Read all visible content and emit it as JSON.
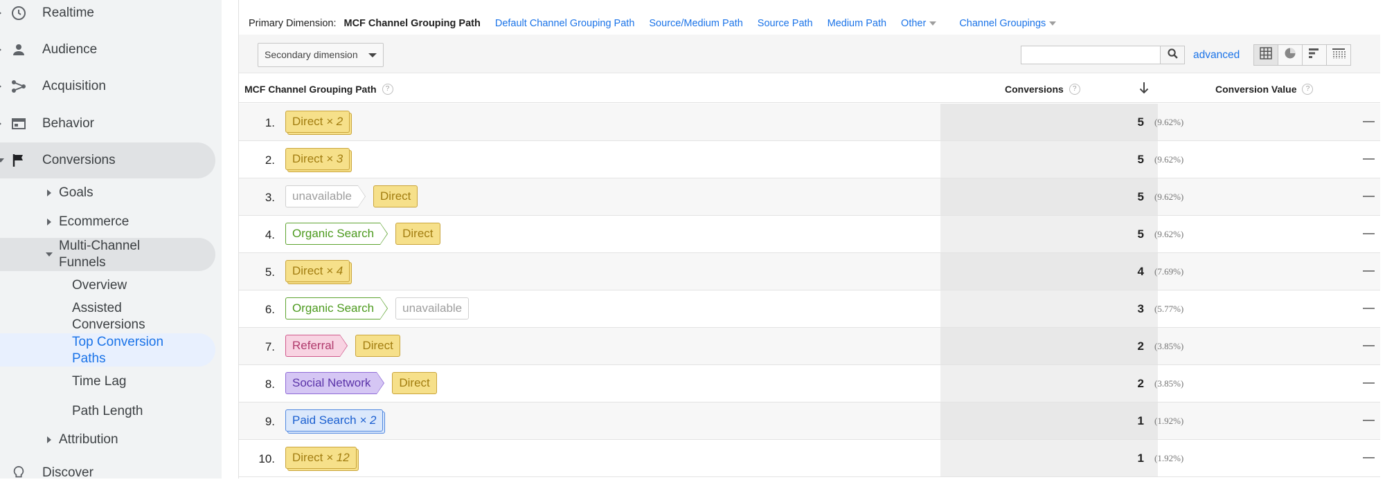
{
  "sidebar": {
    "top_items": [
      {
        "label": "Realtime",
        "icon": "clock-icon"
      },
      {
        "label": "Audience",
        "icon": "person-icon"
      },
      {
        "label": "Acquisition",
        "icon": "acquisition-icon"
      },
      {
        "label": "Behavior",
        "icon": "behavior-icon"
      },
      {
        "label": "Conversions",
        "icon": "flag-icon"
      }
    ],
    "conversion_items": [
      {
        "label": "Goals"
      },
      {
        "label": "Ecommerce"
      },
      {
        "label": "Multi-Channel Funnels"
      }
    ],
    "mcf_items": [
      {
        "label": "Overview"
      },
      {
        "label": "Assisted Conversions"
      },
      {
        "label": "Top Conversion Paths"
      },
      {
        "label": "Time Lag"
      },
      {
        "label": "Path Length"
      }
    ],
    "attribution_label": "Attribution",
    "discover": {
      "label": "Discover",
      "icon": "lightbulb-icon"
    }
  },
  "dimensions": {
    "label": "Primary Dimension:",
    "active": "MCF Channel Grouping Path",
    "links": [
      "Default Channel Grouping Path",
      "Source/Medium Path",
      "Source Path",
      "Medium Path"
    ],
    "other": "Other",
    "channel_groupings": "Channel Groupings"
  },
  "toolbar": {
    "secondary_dimension": "Secondary dimension",
    "search_value": "",
    "advanced": "advanced"
  },
  "table": {
    "col_path": "MCF Channel Grouping Path",
    "col_conversions": "Conversions",
    "col_value": "Conversion Value",
    "rows": [
      {
        "num": "1.",
        "path": [
          {
            "type": "direct",
            "label": "Direct",
            "mult": "× 2"
          }
        ],
        "conversions": "5",
        "pct": "(9.62%)",
        "value": "—"
      },
      {
        "num": "2.",
        "path": [
          {
            "type": "direct",
            "label": "Direct",
            "mult": "× 3"
          }
        ],
        "conversions": "5",
        "pct": "(9.62%)",
        "value": "—"
      },
      {
        "num": "3.",
        "path": [
          {
            "type": "unavail",
            "label": "unavailable"
          },
          {
            "type": "direct",
            "label": "Direct"
          }
        ],
        "conversions": "5",
        "pct": "(9.62%)",
        "value": "—"
      },
      {
        "num": "4.",
        "path": [
          {
            "type": "organic",
            "label": "Organic Search"
          },
          {
            "type": "direct",
            "label": "Direct"
          }
        ],
        "conversions": "5",
        "pct": "(9.62%)",
        "value": "—"
      },
      {
        "num": "5.",
        "path": [
          {
            "type": "direct",
            "label": "Direct",
            "mult": "× 4"
          }
        ],
        "conversions": "4",
        "pct": "(7.69%)",
        "value": "—"
      },
      {
        "num": "6.",
        "path": [
          {
            "type": "organic",
            "label": "Organic Search"
          },
          {
            "type": "unavail",
            "label": "unavailable"
          }
        ],
        "conversions": "3",
        "pct": "(5.77%)",
        "value": "—"
      },
      {
        "num": "7.",
        "path": [
          {
            "type": "referral",
            "label": "Referral"
          },
          {
            "type": "direct",
            "label": "Direct"
          }
        ],
        "conversions": "2",
        "pct": "(3.85%)",
        "value": "—"
      },
      {
        "num": "8.",
        "path": [
          {
            "type": "social",
            "label": "Social Network"
          },
          {
            "type": "direct",
            "label": "Direct"
          }
        ],
        "conversions": "2",
        "pct": "(3.85%)",
        "value": "—"
      },
      {
        "num": "9.",
        "path": [
          {
            "type": "paid",
            "label": "Paid Search",
            "mult": "× 2"
          }
        ],
        "conversions": "1",
        "pct": "(1.92%)",
        "value": "—"
      },
      {
        "num": "10.",
        "path": [
          {
            "type": "direct",
            "label": "Direct",
            "mult": "× 12"
          }
        ],
        "conversions": "1",
        "pct": "(1.92%)",
        "value": "—"
      }
    ]
  },
  "colors": {
    "link": "#1a73e8",
    "direct_chip": "#f6e08a",
    "organic_chip_border": "#5ca32e",
    "referral_chip": "#f8d3e2",
    "social_chip": "#d5c6f4",
    "paid_chip": "#dbe8fb",
    "selected_nav": "#e8f0fe"
  }
}
